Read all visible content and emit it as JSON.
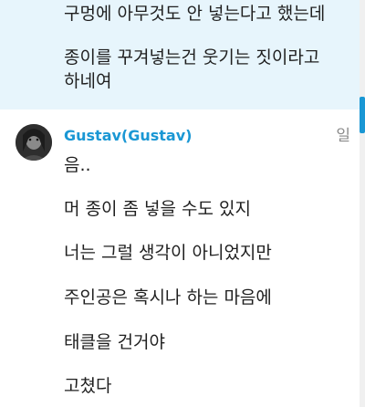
{
  "previous_message": {
    "lines": [
      "구멍에 아무것도 안 넣는다고 했는데",
      "종이를 꾸겨넣는건 웃기는 짓이라고",
      "하네여"
    ]
  },
  "message": {
    "sender": "Gustav(Gustav)",
    "time": "일",
    "avatar_icon": "user-portrait-icon",
    "lines": [
      "음..",
      "머 종이 좀 넣을 수도 있지",
      "너는 그럴 생각이 아니었지만",
      "주인공은 혹시나 하는 마음에",
      "태클을 건거야",
      "고쳤다"
    ]
  },
  "colors": {
    "highlight_background": "#e7f5fc",
    "sender_name": "#1a97d4",
    "scrollbar_thumb": "#1a97d4"
  }
}
